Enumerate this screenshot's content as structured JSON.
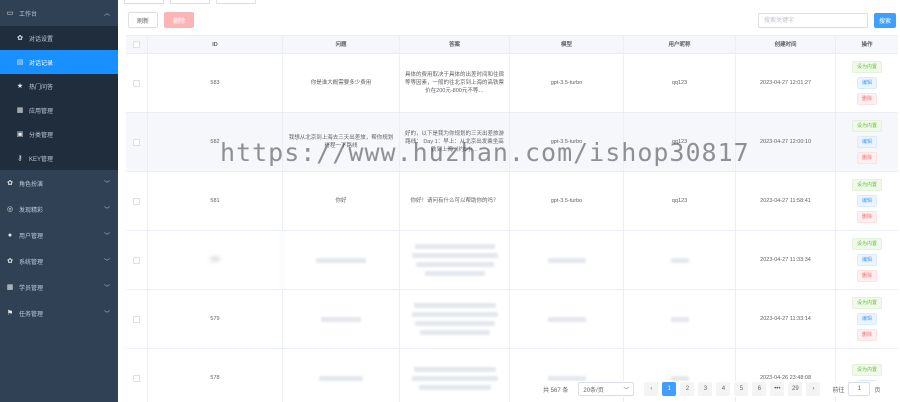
{
  "sidebar": {
    "items": [
      {
        "label": "工作台",
        "icon": "monitor-icon",
        "expanded": true
      },
      {
        "label": "对话设置",
        "icon": "gear-icon",
        "sub": true
      },
      {
        "label": "对话记录",
        "icon": "chat-record-icon",
        "sub": true,
        "active": true
      },
      {
        "label": "热门问答",
        "icon": "star-icon",
        "sub": true
      },
      {
        "label": "应用管理",
        "icon": "grid-icon",
        "sub": true
      },
      {
        "label": "分类管理",
        "icon": "category-icon",
        "sub": true
      },
      {
        "label": "KEY管理",
        "icon": "key-icon",
        "sub": true
      },
      {
        "label": "角色扮演",
        "icon": "gear-icon"
      },
      {
        "label": "发现精彩",
        "icon": "compass-icon"
      },
      {
        "label": "用户管理",
        "icon": "user-icon"
      },
      {
        "label": "系统管理",
        "icon": "gear-icon"
      },
      {
        "label": "学员管理",
        "icon": "grid-icon"
      },
      {
        "label": "任务管理",
        "icon": "flag-icon"
      }
    ]
  },
  "toolbar": {
    "refresh_label": "刷新",
    "delete_label": "删除"
  },
  "search": {
    "placeholder": "搜索关键字",
    "button_label": "搜索"
  },
  "table": {
    "headers": {
      "id": "ID",
      "question": "问题",
      "answer": "答案",
      "model": "模型",
      "user": "用户昵称",
      "time": "创建时间",
      "ops": "操作"
    },
    "rows": [
      {
        "id": "583",
        "question": "你是谁大概需要多少费用",
        "answer": "具体的费用取决于具体的出差时间和住宿等等因素，一般的往北京到上海的高铁票价在200元-800元不等…",
        "model": "gpt-3.5-turbo",
        "user": "qq123",
        "time": "2023-04-27 12:01:27"
      },
      {
        "id": "582",
        "question": "我想从北京到上海去三天出差旅，帮你规划行程一下路线",
        "answer": "好的，以下是我为你规划的三天出差旅游路线： Day 1：早上：从北京出发乘坐高铁到上海（约5小…",
        "model": "gpt-3.5-turbo",
        "user": "qq123",
        "time": "2023-04-27 12:00:10"
      },
      {
        "id": "581",
        "question": "你好",
        "answer": "你好！请问有什么可以帮助你的吗？",
        "model": "gpt-3.5-turbo",
        "user": "qq123",
        "time": "2023-04-27 11:58:41"
      },
      {
        "id": "580",
        "question": "",
        "answer": "",
        "model": "",
        "user": "",
        "time": "2023-04-27 11:33:34"
      },
      {
        "id": "579",
        "question": "",
        "answer": "",
        "model": "",
        "user": "",
        "time": "2023-04-27 11:33:14"
      },
      {
        "id": "578",
        "question": "",
        "answer": "",
        "model": "",
        "user": "",
        "time": "2023-04-26 23:48:08"
      }
    ],
    "op_set_hot": "设为内置",
    "op_edit": "编辑",
    "op_delete": "删除"
  },
  "pagination": {
    "total": "共 567 条",
    "page_size": "20条/页",
    "pages": [
      "1",
      "2",
      "3",
      "4",
      "5",
      "6",
      "•••",
      "29"
    ],
    "current": "1",
    "goto_label": "前往",
    "goto_value": "1",
    "page_suffix": "页"
  },
  "watermark": "https://www.huzhan.com/ishop30817"
}
